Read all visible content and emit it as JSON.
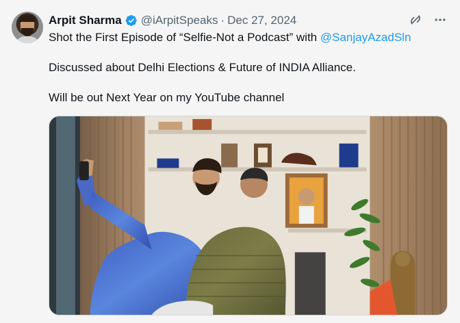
{
  "author": {
    "name": "Arpit Sharma",
    "handle": "@iArpitSpeaks",
    "separator": "·",
    "date": "Dec 27, 2024"
  },
  "icons": {
    "verified": "verified-badge-icon",
    "grok": "grok-icon",
    "more": "more-icon"
  },
  "colors": {
    "accent": "#1d9bf0",
    "text": "#0f1419",
    "muted": "#536471"
  },
  "post": {
    "line1_prefix": "Shot the First Episode of “Selfie-Not a Podcast” with ",
    "line1_mention": "@SanjayAzadSln",
    "line2": "Discussed about Delhi Elections & Future of INDIA Alliance.",
    "line3": "Will be out Next Year on my YouTube channel"
  }
}
